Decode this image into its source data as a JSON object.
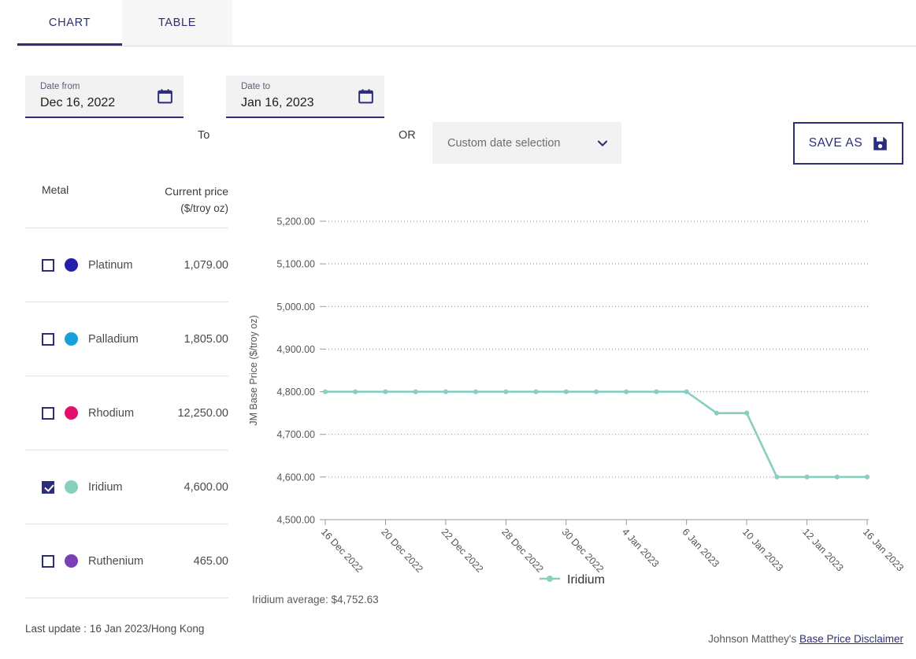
{
  "tabs": [
    {
      "label": "CHART",
      "active": true
    },
    {
      "label": "TABLE",
      "active": false
    }
  ],
  "filters": {
    "date_from_label": "Date from",
    "date_from_value": "Dec 16, 2022",
    "to_word": "To",
    "date_to_label": "Date to",
    "date_to_value": "Jan 16, 2023",
    "or_word": "OR",
    "custom_selection": "Custom date selection",
    "save_as_label": "SAVE AS",
    "calendar_icon": "calendar-icon",
    "chevron_icon": "chevron-down-icon",
    "save_icon": "save-disk-icon"
  },
  "sidebar": {
    "header_metal": "Metal",
    "header_price": "Current price",
    "header_price_unit": "($/troy oz)",
    "rows": [
      {
        "name": "Platinum",
        "price": "1,079.00",
        "color": "#241FA8",
        "checked": false
      },
      {
        "name": "Palladium",
        "price": "1,805.00",
        "color": "#18A0DB",
        "checked": false
      },
      {
        "name": "Rhodium",
        "price": "12,250.00",
        "color": "#E3106B",
        "checked": false
      },
      {
        "name": "Iridium",
        "price": "4,600.00",
        "color": "#88CFC0",
        "checked": true
      },
      {
        "name": "Ruthenium",
        "price": "465.00",
        "color": "#7A3FB5",
        "checked": false
      }
    ],
    "last_update": "Last update : 16 Jan 2023/Hong Kong"
  },
  "chart_data": {
    "type": "line",
    "title": "",
    "xlabel": "",
    "ylabel": "JM Base Price ($/troy oz)",
    "ylim": [
      4500,
      5200
    ],
    "yticks": [
      4500,
      4600,
      4700,
      4800,
      4900,
      5000,
      5100,
      5200
    ],
    "ytick_labels": [
      "4,500.00",
      "4,600.00",
      "4,700.00",
      "4,800.00",
      "4,900.00",
      "5,000.00",
      "5,100.00",
      "5,200.00"
    ],
    "grid": true,
    "legend": [
      "Iridium"
    ],
    "legend_position": "bottom-center",
    "line_color": "#88CFC0",
    "xtick_labels": [
      "16 Dec 2022",
      "20 Dec 2022",
      "22 Dec 2022",
      "28 Dec 2022",
      "30 Dec 2022",
      "4 Jan 2023",
      "6 Jan 2023",
      "10 Jan 2023",
      "12 Jan 2023",
      "16 Jan 2023"
    ],
    "xtick_indices": [
      0,
      2,
      4,
      6,
      8,
      10,
      12,
      14,
      16,
      18
    ],
    "series": [
      {
        "name": "Iridium",
        "values": [
          4800,
          4800,
          4800,
          4800,
          4800,
          4800,
          4800,
          4800,
          4800,
          4800,
          4800,
          4800,
          4800,
          4750,
          4750,
          4600,
          4600,
          4600,
          4600
        ]
      }
    ],
    "annotation": "Iridium average: $4,752.63"
  },
  "footer": {
    "prefix": "Johnson Matthey's ",
    "link": "Base Price Disclaimer"
  }
}
